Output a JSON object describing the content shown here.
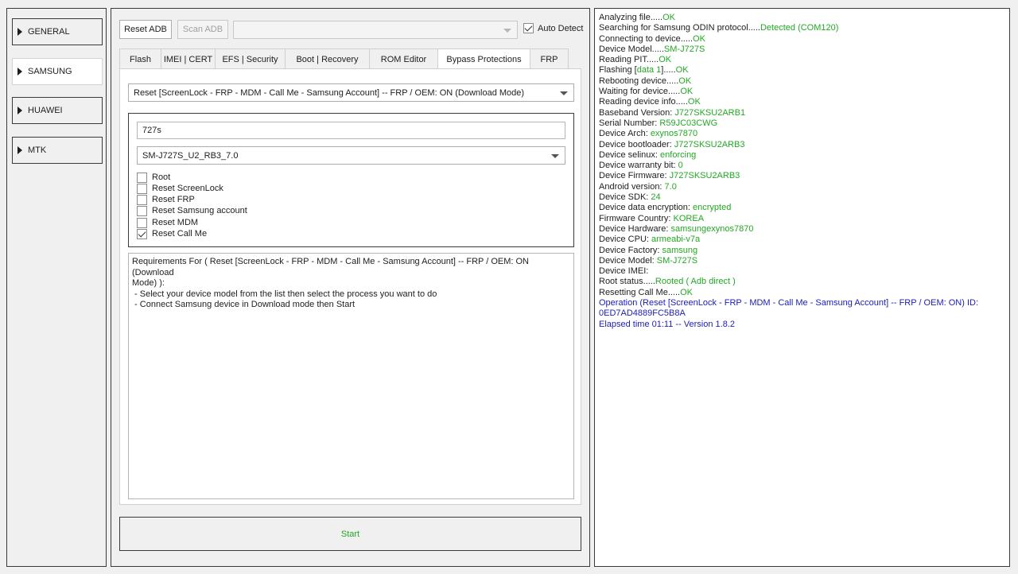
{
  "colors": {
    "ok_green": "#22a822",
    "info_blue": "#1c1cb8",
    "text": "#1e1e1e"
  },
  "nav": {
    "items": [
      {
        "label": "GENERAL",
        "active": false
      },
      {
        "label": "SAMSUNG",
        "active": true
      },
      {
        "label": "HUAWEI",
        "active": false
      },
      {
        "label": "MTK",
        "active": false
      }
    ]
  },
  "toolbar": {
    "reset_adb": "Reset ADB",
    "scan_adb": "Scan ADB",
    "port_value": "",
    "auto_detect": "Auto Detect",
    "auto_detect_checked": true
  },
  "tabs": [
    {
      "label": "Flash",
      "active": false
    },
    {
      "label": "IMEI | CERT",
      "active": false
    },
    {
      "label": "EFS | Security",
      "active": false
    },
    {
      "label": "Boot | Recovery",
      "active": false
    },
    {
      "label": "ROM Editor",
      "active": false
    },
    {
      "label": "Bypass Protections",
      "active": true
    },
    {
      "label": "FRP",
      "active": false
    }
  ],
  "bypass": {
    "operation": "Reset [ScreenLock - FRP - MDM - Call Me - Samsung Account] -- FRP / OEM: ON (Download Mode)",
    "search": "727s",
    "model": "SM-J727S_U2_RB3_7.0",
    "options": [
      {
        "label": "Root",
        "checked": false
      },
      {
        "label": "Reset ScreenLock",
        "checked": false
      },
      {
        "label": "Reset FRP",
        "checked": false
      },
      {
        "label": "Reset Samsung account",
        "checked": false
      },
      {
        "label": "Reset MDM",
        "checked": false
      },
      {
        "label": "Reset Call Me",
        "checked": true
      }
    ],
    "requirements": [
      "Requirements For ( Reset [ScreenLock - FRP - MDM - Call Me - Samsung Account] -- FRP / OEM: ON (Download",
      "Mode) ):",
      " - Select your device model from the list then select the process you want to do",
      " - Connect Samsung device in Download mode then Start"
    ]
  },
  "start_label": "Start",
  "log": [
    {
      "label": "Analyzing file.....",
      "value": "OK",
      "color": "green"
    },
    {
      "label": "Searching for Samsung ODIN protocol.....",
      "value": "Detected (COM120)",
      "color": "green"
    },
    {
      "label": "Connecting to device.....",
      "value": "OK",
      "color": "green"
    },
    {
      "label": "Device Model.....",
      "value": "SM-J727S",
      "color": "green"
    },
    {
      "label": "Reading PIT.....",
      "value": "OK",
      "color": "green"
    },
    {
      "label": "Flashing [",
      "value": "data 1",
      "suffix": "].....",
      "value2": "OK",
      "color": "green"
    },
    {
      "label": "Rebooting device.....",
      "value": "OK",
      "color": "green"
    },
    {
      "label": "Waiting for device.....",
      "value": "OK",
      "color": "green"
    },
    {
      "label": "Reading device info.....",
      "value": "OK",
      "color": "green"
    },
    {
      "label": "Baseband Version: ",
      "value": "J727SKSU2ARB1",
      "color": "green"
    },
    {
      "label": "Serial Number: ",
      "value": "R59JC03CWG",
      "color": "green"
    },
    {
      "label": "Device Arch: ",
      "value": "exynos7870",
      "color": "green"
    },
    {
      "label": "Device bootloader: ",
      "value": "J727SKSU2ARB3",
      "color": "green"
    },
    {
      "label": "Device selinux: ",
      "value": "enforcing",
      "color": "green"
    },
    {
      "label": "Device warranty bit: ",
      "value": "0",
      "color": "green"
    },
    {
      "label": "Device Firmware: ",
      "value": "J727SKSU2ARB3",
      "color": "green"
    },
    {
      "label": "Android version: ",
      "value": "7.0",
      "color": "green"
    },
    {
      "label": "Device SDK: ",
      "value": "24",
      "color": "green"
    },
    {
      "label": "Device data encryption: ",
      "value": "encrypted",
      "color": "green"
    },
    {
      "label": "Firmware Country: ",
      "value": "KOREA",
      "color": "green"
    },
    {
      "label": "Device Hardware: ",
      "value": "samsungexynos7870",
      "color": "green"
    },
    {
      "label": "Device CPU: ",
      "value": "armeabi-v7a",
      "color": "green"
    },
    {
      "label": "Device Factory: ",
      "value": "samsung",
      "color": "green"
    },
    {
      "label": "Device Model: ",
      "value": "SM-J727S",
      "color": "green"
    },
    {
      "label": "Device IMEI: ",
      "value": "",
      "color": "green"
    },
    {
      "label": "Root status.....",
      "value": "Rooted ( Adb direct )",
      "color": "green"
    },
    {
      "label": "Resetting Call Me.....",
      "value": "OK",
      "color": "green"
    },
    {
      "label": "",
      "value": "Operation (Reset [ScreenLock - FRP - MDM - Call Me - Samsung Account] -- FRP / OEM: ON) ID: 0ED7AD4889FC5B8A",
      "color": "blue"
    },
    {
      "label": "",
      "value": "Elapsed time 01:11 -- Version 1.8.2",
      "color": "blue"
    }
  ]
}
